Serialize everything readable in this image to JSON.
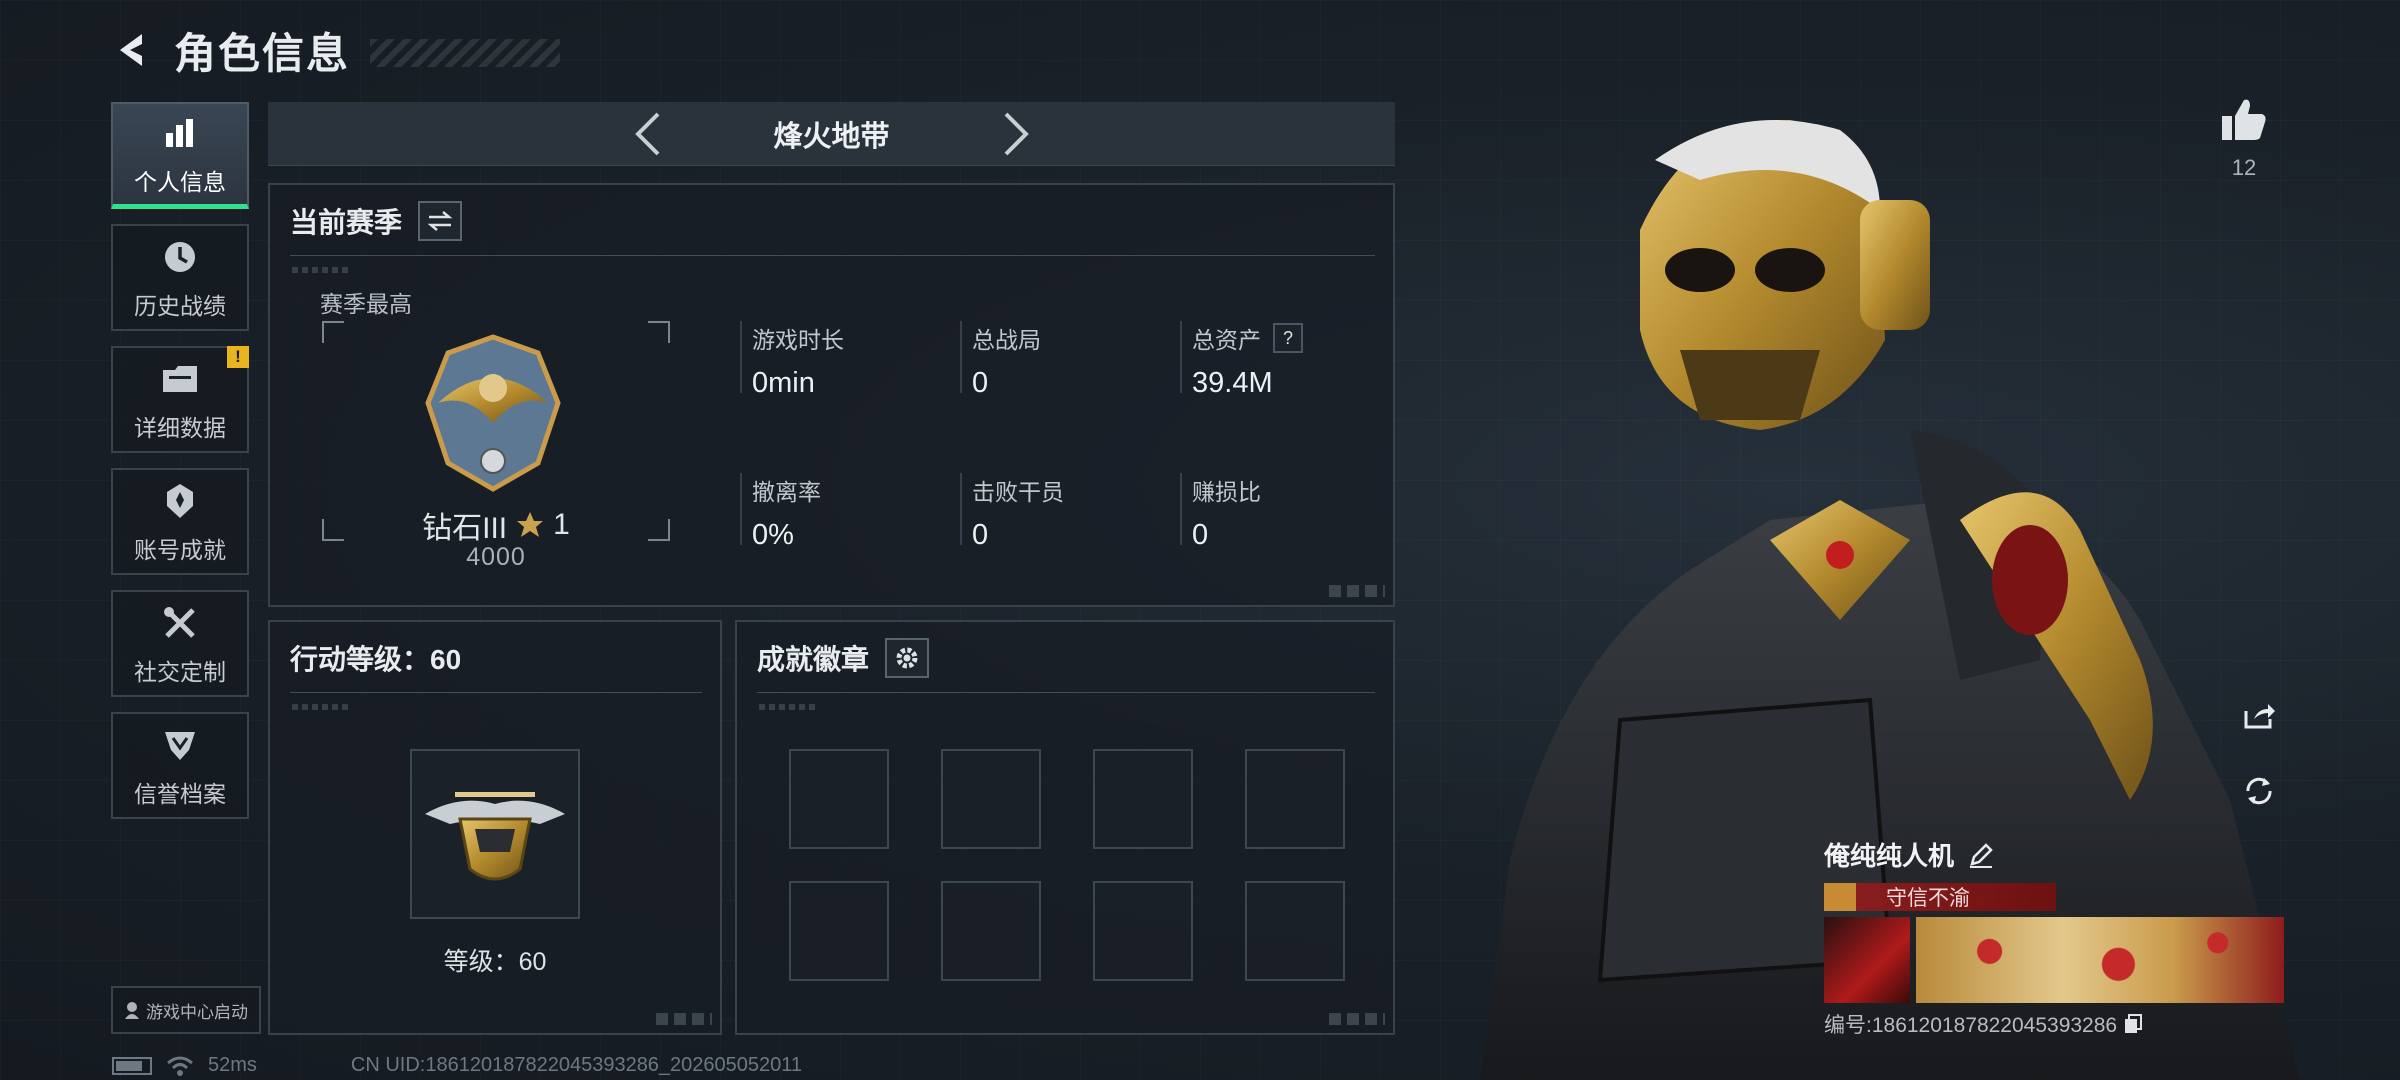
{
  "header": {
    "title": "角色信息"
  },
  "sidebar": {
    "items": [
      {
        "label": "个人信息",
        "icon": "bar-chart-icon",
        "active": true
      },
      {
        "label": "历史战绩",
        "icon": "clock-history-icon"
      },
      {
        "label": "详细数据",
        "icon": "folder-icon",
        "badge": "!"
      },
      {
        "label": "账号成就",
        "icon": "achievement-icon"
      },
      {
        "label": "社交定制",
        "icon": "tools-icon"
      },
      {
        "label": "信誉档案",
        "icon": "shield-icon"
      }
    ],
    "launch_label": "游戏中心启动"
  },
  "zone": {
    "name": "烽火地带"
  },
  "season": {
    "title": "当前赛季",
    "best_label": "赛季最高",
    "rank_name": "钻石III",
    "rank_stars": "1",
    "rank_score": "4000",
    "stats": [
      {
        "label": "游戏时长",
        "value": "0min"
      },
      {
        "label": "总战局",
        "value": "0"
      },
      {
        "label": "总资产",
        "value": "39.4M",
        "help": "?"
      },
      {
        "label": "撤离率",
        "value": "0%"
      },
      {
        "label": "击败干员",
        "value": "0"
      },
      {
        "label": "赚损比",
        "value": "0"
      }
    ]
  },
  "action_level": {
    "title": "行动等级：60",
    "level_text": "等级：60"
  },
  "achievements": {
    "title": "成就徽章"
  },
  "likes": {
    "count": "12"
  },
  "player": {
    "name": "俺纯纯人机",
    "title_badge": "守信不渝",
    "id_text": "编号:18612018782204539328​6"
  },
  "status": {
    "ping": "52ms",
    "uid": "CN UID:18612018782204539328​6_202605052011"
  },
  "colors": {
    "accent": "#2fe08e",
    "alert": "#e8b521",
    "title_red": "#8d1f1f"
  }
}
